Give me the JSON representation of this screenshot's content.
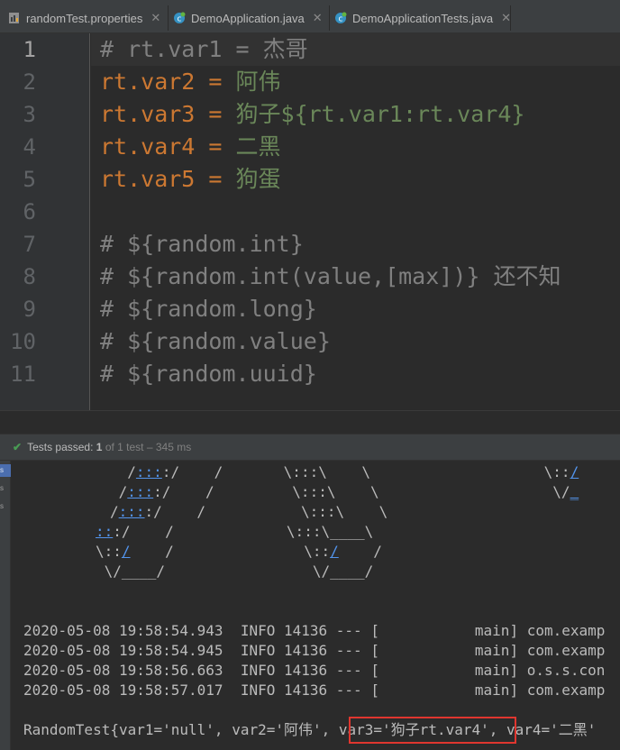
{
  "tabs": [
    {
      "label": "randomTest.properties",
      "icon": "properties-file-icon",
      "active": true
    },
    {
      "label": "DemoApplication.java",
      "icon": "java-class-icon",
      "active": false
    },
    {
      "label": "DemoApplicationTests.java",
      "icon": "java-test-class-icon",
      "active": false
    }
  ],
  "close_glyph": "✕",
  "editor": {
    "line_numbers": [
      "1",
      "2",
      "3",
      "4",
      "5",
      "6",
      "7",
      "8",
      "9",
      "10",
      "11"
    ],
    "lines": [
      {
        "comment": "# rt.var1 = 杰哥"
      },
      {
        "key": "rt.var2 = ",
        "value": "阿伟"
      },
      {
        "key": "rt.var3 = ",
        "value": "狗子${rt.var1:rt.var4}"
      },
      {
        "key": "rt.var4 = ",
        "value": "二黑"
      },
      {
        "key": "rt.var5 = ",
        "value": "狗蛋"
      },
      {
        "comment": ""
      },
      {
        "comment": "# ${random.int}"
      },
      {
        "comment": "# ${random.int(value,[max])} 还不知"
      },
      {
        "comment": "# ${random.long}"
      },
      {
        "comment": "# ${random.value}"
      },
      {
        "comment": "# ${random.uuid}"
      }
    ]
  },
  "run_panel": {
    "status_prefix": "Tests passed:",
    "passed": "1",
    "status_rest": "of 1 test – 345 ms",
    "side_labels": [
      "s",
      "s",
      "s"
    ]
  },
  "console": {
    "banner": [
      {
        "pre": "  /",
        "u": ":::",
        "post": ":/    /       \\:::\\    \\                    \\::",
        "u2": "/"
      },
      {
        "pre": " /",
        "u": ":::",
        "post": ":/    /         \\:::\\    \\                    \\/",
        "u2": "_"
      },
      {
        "pre": "/",
        "u": ":::",
        "post": ":/    /           \\:::\\    \\"
      },
      {
        "pre": "",
        "u": "::",
        "post": ":/    /             \\:::\\____\\"
      },
      {
        "pre": "\\::",
        "u": "/",
        "post": "    /               \\::",
        "u2": "/",
        "post2": "    /"
      },
      {
        "pre": " \\/____/                 \\/____/"
      }
    ],
    "logs": [
      "2020-05-08 19:58:54.943  INFO 14136 --- [           main] com.examp",
      "2020-05-08 19:58:54.945  INFO 14136 --- [           main] com.examp",
      "2020-05-08 19:58:56.663  INFO 14136 --- [           main] o.s.s.con",
      "2020-05-08 19:58:57.017  INFO 14136 --- [           main] com.examp"
    ],
    "result_line": "RandomTest{var1='null', var2='阿伟', var3='狗子rt.var4', var4='二黑'"
  },
  "colors": {
    "comment": "#808080",
    "key": "#cc7832",
    "value": "#6a8759",
    "highlight_border": "#e0362f",
    "check": "#499c54"
  }
}
